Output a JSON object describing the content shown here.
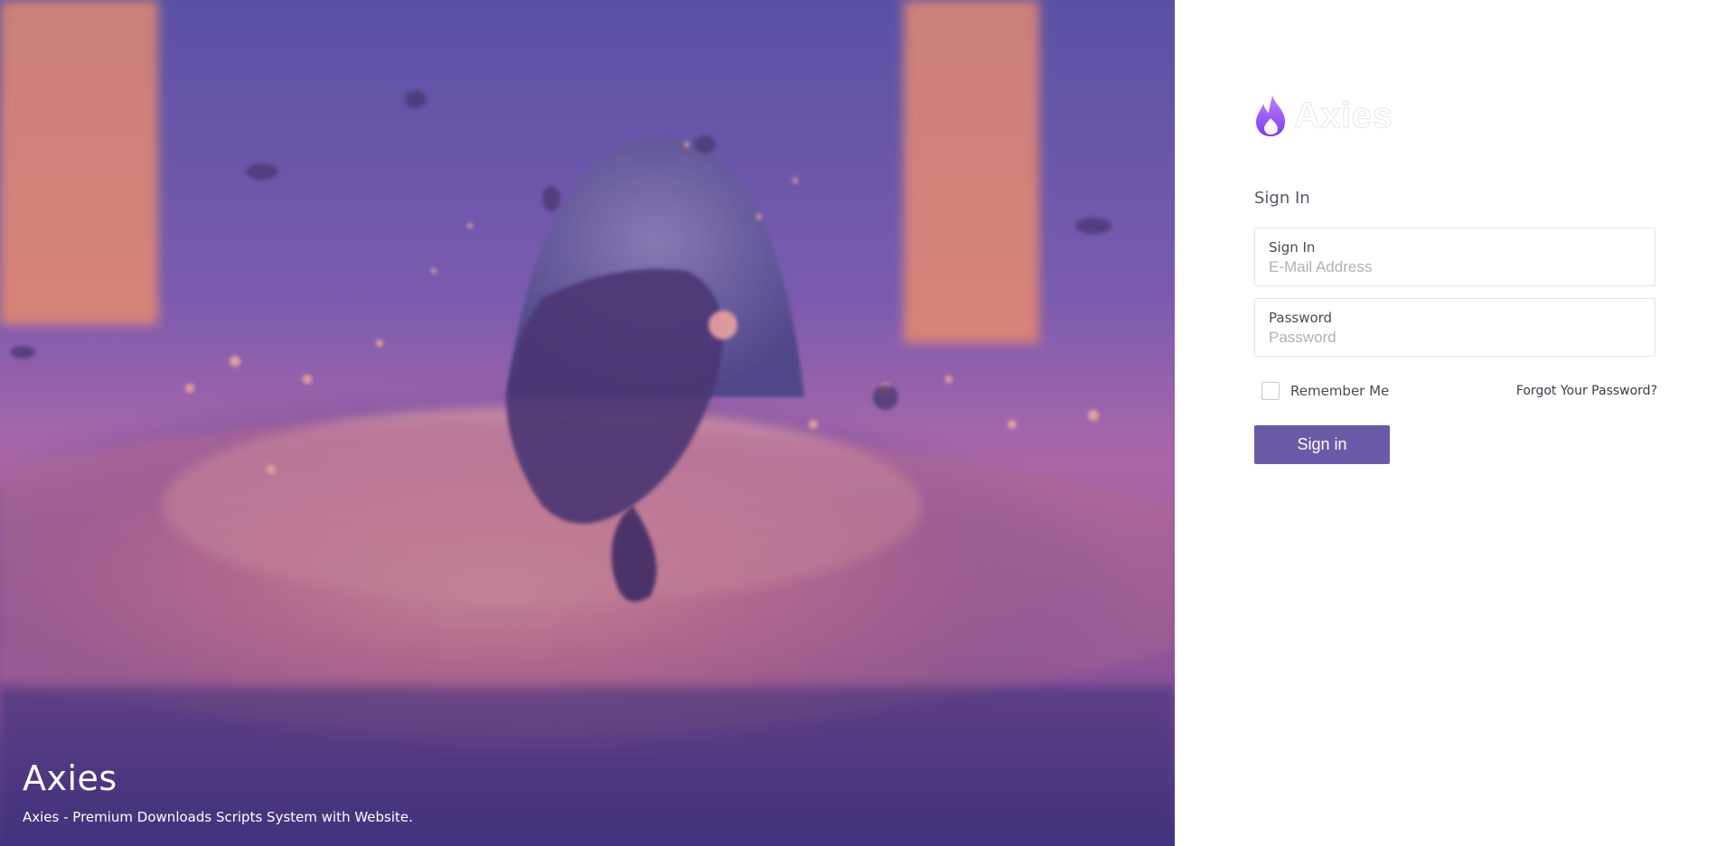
{
  "hero": {
    "title": "Axies",
    "subtitle": "Axies - Premium Downloads Scripts System with Website."
  },
  "brand": {
    "name": "Axies",
    "icon": "flame-icon",
    "icon_colors": [
      "#a855f7",
      "#6d28d9"
    ]
  },
  "form": {
    "heading": "Sign In",
    "email": {
      "label": "Sign In",
      "placeholder": "E-Mail Address",
      "value": ""
    },
    "password": {
      "label": "Password",
      "placeholder": "Password",
      "value": ""
    },
    "remember_label": "Remember Me",
    "remember_checked": false,
    "forgot_label": "Forgot Your Password?",
    "submit_label": "Sign in"
  },
  "colors": {
    "accent": "#6b5aa8",
    "hero_tint": "#6d5aa6"
  }
}
